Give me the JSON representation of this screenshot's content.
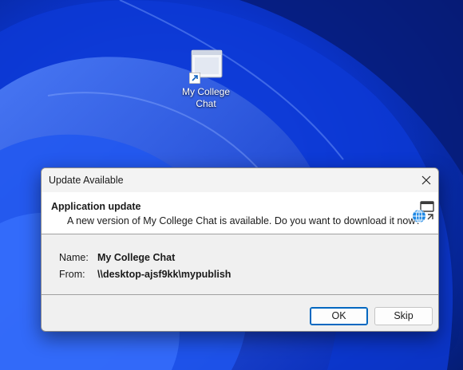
{
  "desktop": {
    "shortcut": {
      "caption": "My College Chat",
      "icon": "application-window-icon",
      "overlay": "shortcut-arrow-icon"
    }
  },
  "dialog": {
    "title": "Update Available",
    "close_icon": "close-icon",
    "header": {
      "title": "Application update",
      "message": "A new version of My College Chat is available. Do you want to download it now?",
      "icon": "globe-update-icon"
    },
    "details": {
      "name_label": "Name:",
      "name_value": "My College Chat",
      "from_label": "From:",
      "from_value": "\\\\desktop-ajsf9kk\\mypublish"
    },
    "buttons": {
      "ok": "OK",
      "skip": "Skip"
    }
  },
  "colors": {
    "accent": "#0067c0",
    "wallpaper": "#0a2a8f"
  }
}
